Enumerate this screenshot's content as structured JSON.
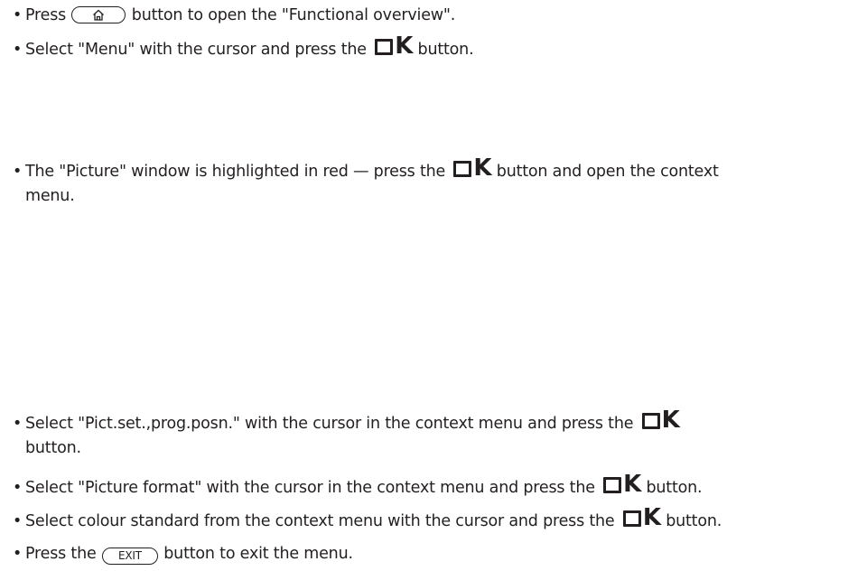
{
  "steps": [
    {
      "before": "Press ",
      "button": "home",
      "after": " button to open the \"Functional overview\"."
    },
    {
      "before": "Select \"Menu\" with the cursor and press the ",
      "button": "ok",
      "after": " button."
    },
    {
      "before": "The \"Picture\" window is highlighted in red — press the ",
      "button": "ok",
      "after": " button and open the context",
      "line2": "menu."
    },
    {
      "before": "Select \"Pict.set.,prog.posn.\" with the cursor in the context menu and press the ",
      "button": "ok",
      "after": "",
      "line2": "button."
    },
    {
      "before": "Select \"Picture format\" with the cursor in the context menu and press the ",
      "button": "ok",
      "after": " button."
    },
    {
      "before": "Select colour standard from the context menu with the cursor and press the ",
      "button": "ok",
      "after": " button."
    },
    {
      "before": "Press the ",
      "button": "exit",
      "after": " button to exit the menu."
    }
  ],
  "buttons": {
    "home_icon": "home-icon",
    "ok_label_k": "K",
    "exit_label": "EXIT"
  }
}
